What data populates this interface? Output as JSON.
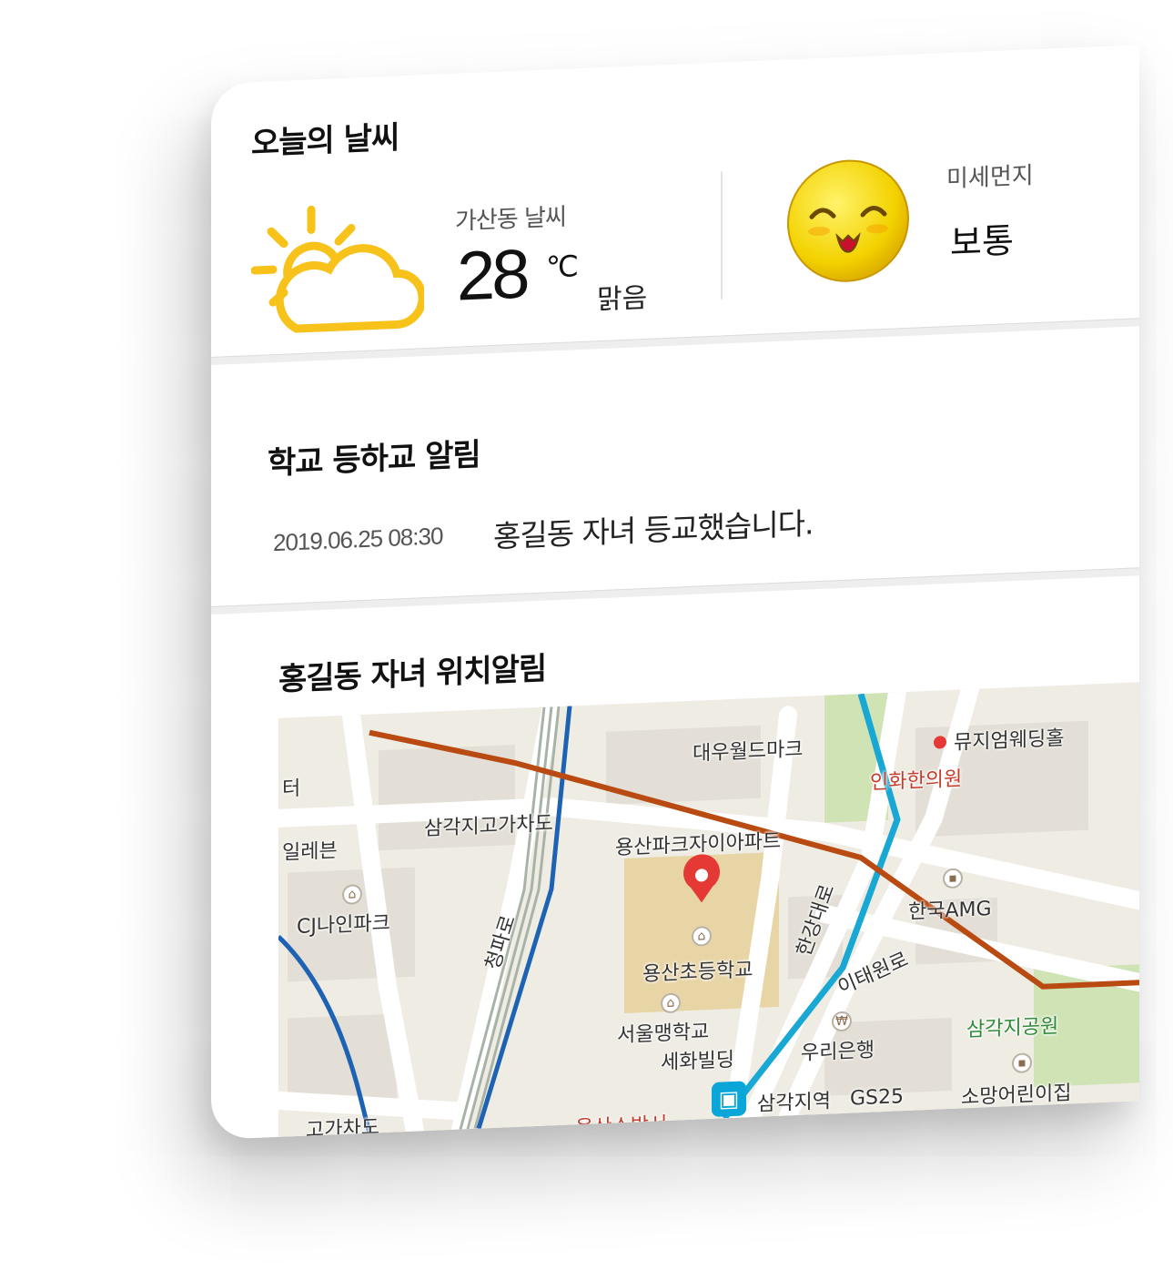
{
  "weather": {
    "title": "오늘의 날씨",
    "region": "가산동 날씨",
    "temperature": "28",
    "unit": "℃",
    "condition": "맑음",
    "icon": "partly-sunny-icon",
    "dust_label": "미세먼지",
    "dust_value": "보통",
    "dust_icon": "smiling-face-icon"
  },
  "school": {
    "title": "학교 등하교 알림",
    "time": "2019.06.25 08:30",
    "message": "홍길동 자녀 등교했습니다."
  },
  "location": {
    "title": "홍길동 자녀 위치알림",
    "map_labels": {
      "daewoo": "대우월드마크",
      "museum": "뮤지엄웨딩홀",
      "inhwa": "인화한의원",
      "samgak_overpass": "삼각지고가차도",
      "yongsan_park": "용산파크자이아파트",
      "ter": "터",
      "eleven": "일레븐",
      "cj": "CJ나인파크",
      "cheongpa": "청파로",
      "hangang": "한강대로",
      "hankook": "한국AMG",
      "itaewon": "이태원로",
      "school": "용산초등학교",
      "seoul_blind": "서울맹학교",
      "sehwa": "세화빌딩",
      "woori": "우리은행",
      "samgak_park": "삼각지공원",
      "samgak_station": "삼각지역",
      "gs25": "GS25",
      "somang": "소망어린이집",
      "overpass2": "고가차도",
      "fire": "용산소방서"
    }
  },
  "colors": {
    "sun": "#f7c21a",
    "face": "#f3d200",
    "rail_orange": "#b84a12",
    "line_blue": "#1e63b3",
    "line_cyan": "#19a7d4",
    "pin_red": "#e53935"
  }
}
